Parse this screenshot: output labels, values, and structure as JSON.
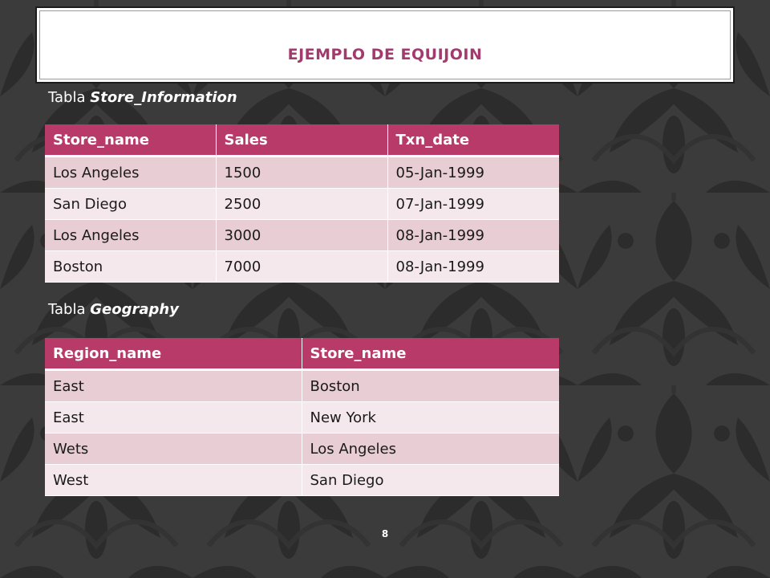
{
  "slide": {
    "title": "EJEMPLO DE EQUIJOIN",
    "page_number": "8"
  },
  "table1": {
    "caption_prefix": "Tabla",
    "caption_name": "Store_Information",
    "headers": [
      "Store_name",
      "Sales",
      "Txn_date"
    ],
    "rows": [
      [
        "Los Angeles",
        "1500",
        "05-Jan-1999"
      ],
      [
        "San Diego",
        "2500",
        "07-Jan-1999"
      ],
      [
        "Los Angeles",
        "3000",
        "08-Jan-1999"
      ],
      [
        "Boston",
        "7000",
        "08-Jan-1999"
      ]
    ]
  },
  "table2": {
    "caption_prefix": "Tabla",
    "caption_name": "Geography",
    "headers": [
      "Region_name",
      "Store_name"
    ],
    "rows": [
      [
        "East",
        "Boston"
      ],
      [
        "East",
        "New York"
      ],
      [
        "Wets",
        "Los Angeles"
      ],
      [
        "West",
        "San Diego"
      ]
    ]
  },
  "colors": {
    "accent": "#b73a69",
    "title": "#a33a6e",
    "row_dark": "#e8cdd5",
    "row_light": "#f5e8ec",
    "background": "#3b3b3b"
  }
}
